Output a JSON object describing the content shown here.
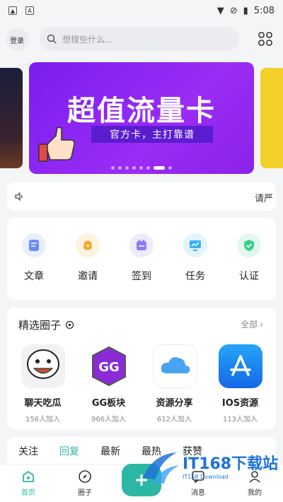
{
  "status": {
    "time": "5:08"
  },
  "topbar": {
    "login_label": "登录",
    "search_placeholder": "想搜些什么..."
  },
  "banner": {
    "title": "超值流量卡",
    "subtitle": "官方卡，主打靠谱"
  },
  "notice": {
    "text": "请严"
  },
  "functions": [
    {
      "label": "文章",
      "color": "#6b8cf5",
      "bg": "#e9efff",
      "icon": "article-icon"
    },
    {
      "label": "邀请",
      "color": "#f5a623",
      "bg": "#fff3df",
      "icon": "invite-icon"
    },
    {
      "label": "签到",
      "color": "#8b7bf5",
      "bg": "#efeaff",
      "icon": "checkin-icon"
    },
    {
      "label": "任务",
      "color": "#3ab0f5",
      "bg": "#e3f4ff",
      "icon": "task-icon"
    },
    {
      "label": "认证",
      "color": "#3ad08a",
      "bg": "#e2f8ee",
      "icon": "verify-icon"
    }
  ],
  "circles_section": {
    "title": "精选圈子",
    "all_label": "全部",
    "items": [
      {
        "name": "聊天吃瓜",
        "count": "156人加入",
        "icon": "meme-icon"
      },
      {
        "name": "GG板块",
        "count": "966人加入",
        "icon": "gg-icon"
      },
      {
        "name": "资源分享",
        "count": "612人加入",
        "icon": "cloud-icon"
      },
      {
        "name": "IOS资源",
        "count": "113人加入",
        "icon": "appstore-icon"
      }
    ]
  },
  "feed_tabs": [
    "关注",
    "回复",
    "最新",
    "最热",
    "获赞"
  ],
  "bottom_nav": [
    {
      "label": "首页",
      "icon": "home-icon"
    },
    {
      "label": "圈子",
      "icon": "compass-icon"
    },
    {
      "label": "",
      "icon": "plus-icon"
    },
    {
      "label": "消息",
      "icon": "message-icon"
    },
    {
      "label": "我的",
      "icon": "profile-icon"
    }
  ],
  "watermark": {
    "text": "IT168下载站",
    "sub": "IT168 Download"
  },
  "colors": {
    "accent": "#2bb7a3",
    "banner": "#8b22e8"
  }
}
